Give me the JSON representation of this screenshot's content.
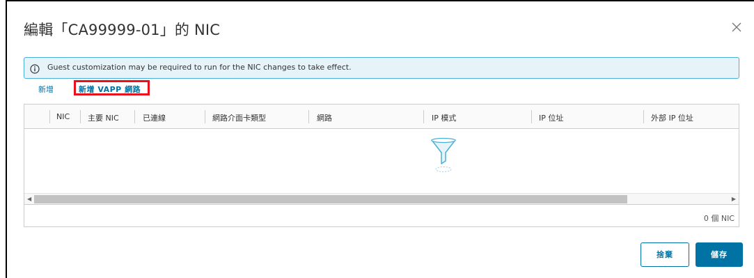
{
  "dialog": {
    "title": "編輯「CA99999-01」的 NIC",
    "close_icon": "close-icon"
  },
  "alert": {
    "icon": "info-icon",
    "text": "Guest customization may be required to run for the NIC changes to take effect."
  },
  "actions": {
    "add_label": "新增",
    "add_vapp_label": "新增 VAPP 網路"
  },
  "grid": {
    "columns": [
      "NIC",
      "主要 NIC",
      "已連線",
      "網路介面卡類型",
      "網路",
      "IP 模式",
      "IP 位址",
      "外部 IP 位址"
    ],
    "rows": [],
    "empty_icon": "filter-funnel-icon",
    "footer_count": "0 個 NIC"
  },
  "buttons": {
    "cancel_label": "捨棄",
    "save_label": "儲存"
  },
  "colors": {
    "accent": "#0072a3",
    "alert_bg": "#e6f4fa",
    "alert_border": "#49afd9",
    "highlight": "#e8101a"
  }
}
